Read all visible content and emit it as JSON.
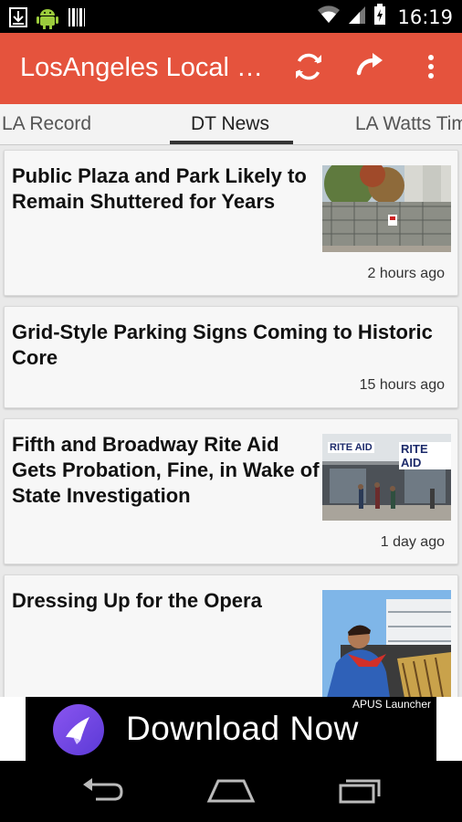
{
  "status_bar": {
    "time": "16:19",
    "icons": [
      "download-icon",
      "android-icon",
      "barcode-icon",
      "wifi-icon",
      "signal-icon",
      "battery-charging-icon"
    ]
  },
  "app_bar": {
    "title": "LosAngeles Local News",
    "actions": [
      "refresh-icon",
      "share-icon",
      "overflow-menu-icon"
    ],
    "color": "#e5533d"
  },
  "tabs": [
    {
      "label": "LA Record",
      "active": false
    },
    {
      "label": "DT News",
      "active": true
    },
    {
      "label": "LA Watts Times",
      "active": false
    }
  ],
  "articles": [
    {
      "title": "Public Plaza and Park Likely to Remain Shuttered for Years",
      "time": "2 hours ago",
      "has_image": true
    },
    {
      "title": "Grid-Style Parking Signs Coming to Historic Core",
      "time": "15 hours ago",
      "has_image": false
    },
    {
      "title": "Fifth and Broadway Rite Aid Gets Probation, Fine, in Wake of State Investigation",
      "time": "1 day ago",
      "has_image": true,
      "image_text": "RITE AID"
    },
    {
      "title": "Dressing Up for the Opera",
      "time": "",
      "has_image": true
    }
  ],
  "ad": {
    "brand": "APUS Launcher",
    "cta": "Download Now"
  },
  "nav_bar": {
    "buttons": [
      "back-icon",
      "home-icon",
      "recents-icon"
    ]
  }
}
